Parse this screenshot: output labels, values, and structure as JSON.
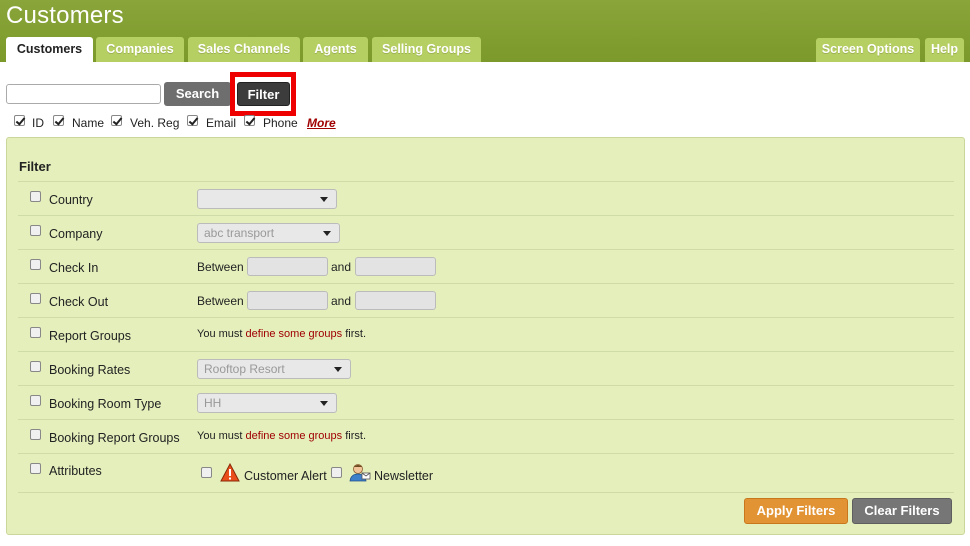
{
  "header": {
    "title": "Customers",
    "tabs": [
      {
        "label": "Customers"
      },
      {
        "label": "Companies"
      },
      {
        "label": "Sales Channels"
      },
      {
        "label": "Agents"
      },
      {
        "label": "Selling Groups"
      }
    ],
    "screen_options": "Screen Options",
    "help": "Help"
  },
  "search": {
    "value": "",
    "button": "Search",
    "filter_button": "Filter"
  },
  "columns": {
    "items": [
      {
        "label": "ID",
        "checked": true
      },
      {
        "label": "Name",
        "checked": true
      },
      {
        "label": "Veh. Reg",
        "checked": true
      },
      {
        "label": "Email",
        "checked": true
      },
      {
        "label": "Phone",
        "checked": true
      }
    ],
    "more": "More"
  },
  "filter": {
    "title": "Filter",
    "rows": [
      {
        "label": "Country",
        "value": ""
      },
      {
        "label": "Company",
        "value": "abc transport"
      },
      {
        "label": "Check In",
        "between": "Between",
        "and": "and"
      },
      {
        "label": "Check Out",
        "between": "Between",
        "and": "and"
      },
      {
        "label": "Report Groups",
        "msg_pre": "You must",
        "msg_link": "define some groups",
        "msg_post": "first."
      },
      {
        "label": "Booking Rates",
        "value": "Rooftop Resort"
      },
      {
        "label": "Booking Room Type",
        "value": "HH"
      },
      {
        "label": "Booking Report Groups",
        "msg_pre": "You must",
        "msg_link": "define some groups",
        "msg_post": "first."
      },
      {
        "label": "Attributes",
        "opt1": "Customer Alert",
        "opt2": "Newsletter"
      }
    ],
    "apply": "Apply Filters",
    "clear": "Clear Filters"
  },
  "colors": {
    "header": "#7b9a2b",
    "tab": "#b6cf62",
    "panel": "#e4efbc",
    "highlight": "#ee0000",
    "link": "#a00000",
    "apply": "#e29435"
  }
}
